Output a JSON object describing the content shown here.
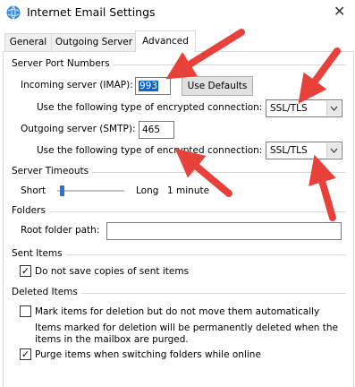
{
  "window": {
    "title": "Internet Email Settings",
    "close_glyph": "✕",
    "app_icon": "globe-envelope-icon"
  },
  "tabs": [
    {
      "label": "General",
      "active": false
    },
    {
      "label": "Outgoing Server",
      "active": false
    },
    {
      "label": "Advanced",
      "active": true
    }
  ],
  "server_ports": {
    "group_label": "Server Port Numbers",
    "incoming_label": "Incoming server (IMAP):",
    "incoming_value": "993",
    "use_defaults_label": "Use Defaults",
    "incoming_encryption_label": "Use the following type of encrypted connection:",
    "incoming_encryption_value": "SSL/TLS",
    "outgoing_label": "Outgoing server (SMTP):",
    "outgoing_value": "465",
    "outgoing_encryption_label": "Use the following type of encrypted connection:",
    "outgoing_encryption_value": "SSL/TLS"
  },
  "timeouts": {
    "group_label": "Server Timeouts",
    "short_label": "Short",
    "long_label": "Long",
    "value_label": "1 minute",
    "slider_fraction": 0.0
  },
  "folders": {
    "group_label": "Folders",
    "root_label": "Root folder path:",
    "root_value": ""
  },
  "sent_items": {
    "group_label": "Sent Items",
    "do_not_save_label": "Do not save copies of sent items",
    "do_not_save_checked": true
  },
  "deleted_items": {
    "group_label": "Deleted Items",
    "mark_label": "Mark items for deletion but do not move them automatically",
    "mark_checked": false,
    "info_line1": "Items marked for deletion will be permanently deleted when the",
    "info_line2": "items in the mailbox are purged.",
    "purge_label": "Purge items when switching folders while online",
    "purge_checked": true
  },
  "annotations": {
    "arrow_color": "#e8413a"
  }
}
